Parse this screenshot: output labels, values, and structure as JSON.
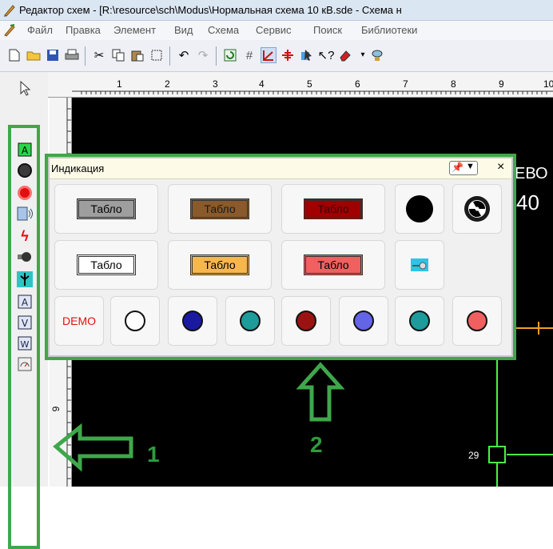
{
  "window": {
    "title": "Редактор схем - [R:\\resource\\sch\\Modus\\Нормальная схема 10 кВ.sde - Схема н"
  },
  "menu": [
    "Файл",
    "Правка",
    "Элемент",
    "Вид",
    "Схема",
    "Сервис",
    "Поиск",
    "Библиотеки"
  ],
  "ruler": {
    "numbers": [
      "1",
      "2",
      "3",
      "4",
      "5",
      "6",
      "7",
      "8",
      "9",
      "10"
    ],
    "left_mark": "6"
  },
  "panel": {
    "title": "Индикация",
    "row1": [
      "Табло",
      "Табло",
      "Табло"
    ],
    "row2": [
      "Табло",
      "Табло",
      "Табло"
    ],
    "demo_label": "DEMO"
  },
  "canvas": {
    "text1": "ЕВО",
    "text2": "40",
    "node_label": "29"
  },
  "annotations": {
    "one": "1",
    "two": "2"
  },
  "colors": {
    "tablo1_bg": "#9e9e9e",
    "tablo2_bg": "#8a5a2b",
    "tablo3_bg": "#a00000",
    "tablo4_bg": "#ffffff",
    "tablo5_bg": "#f7b74f",
    "tablo6_bg": "#f06060",
    "lamp_colors": [
      "#ffffff",
      "#1a1aa0",
      "#1e9b9b",
      "#9b1212",
      "#6464e6",
      "#1e9b9b",
      "#f06060"
    ],
    "annotation_green": "#3fa74b"
  }
}
